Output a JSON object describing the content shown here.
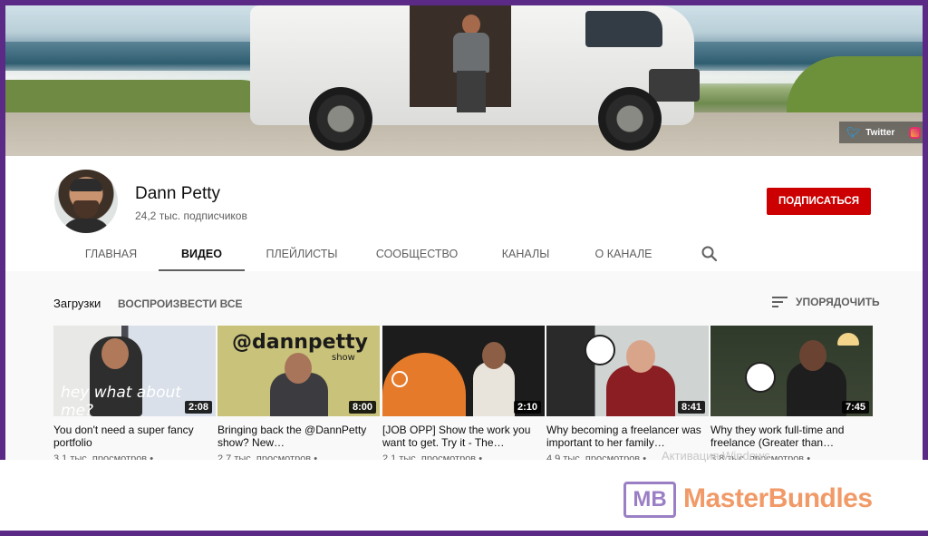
{
  "banner": {
    "social": [
      "Twitter"
    ]
  },
  "channel": {
    "name": "Dann Petty",
    "subscribers": "24,2 тыс. подписчиков",
    "subscribe_label": "ПОДПИСАТЬСЯ"
  },
  "tabs": [
    "ГЛАВНАЯ",
    "ВИДЕО",
    "ПЛЕЙЛИСТЫ",
    "СООБЩЕСТВО",
    "КАНАЛЫ",
    "О КАНАЛЕ"
  ],
  "active_tab": "ВИДЕО",
  "section": {
    "title": "Загрузки",
    "play_all": "ВОСПРОИЗВЕСТИ ВСЕ",
    "sort_label": "УПОРЯДОЧИТЬ"
  },
  "videos": [
    {
      "title": "You don't need a super fancy portfolio",
      "duration": "2:08",
      "meta": "3,1 тыс. просмотров •",
      "overlay": "hey what about me?"
    },
    {
      "title": "Bringing back the @DannPetty show? New…",
      "duration": "8:00",
      "meta": "2,7 тыс. просмотров •",
      "overlay": "@dannpetty",
      "overlay_sub": "show"
    },
    {
      "title": "[JOB OPP] Show the work you want to get. Try it - The…",
      "duration": "2:10",
      "meta": "2,1 тыс. просмотров •"
    },
    {
      "title": "Why becoming a freelancer was important to her family…",
      "duration": "8:41",
      "meta": "4,9 тыс. просмотров •"
    },
    {
      "title": "Why they work full-time and freelance (Greater than…",
      "duration": "7:45",
      "meta": "3,8 тыс. просмотров •"
    }
  ],
  "watermark": {
    "logo": "MB",
    "brand": "MasterBundles",
    "activation_hint": "Активация Windows"
  },
  "colors": {
    "frame": "#5b2a86",
    "subscribe": "#cc0000",
    "brand": "#f19a68",
    "logo": "#9b7fc5"
  }
}
